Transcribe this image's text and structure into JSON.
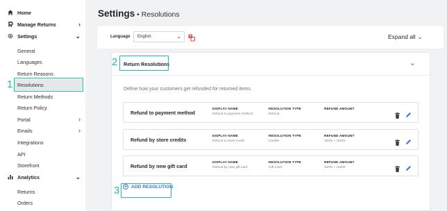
{
  "sidebar": {
    "items": [
      {
        "label": "Home",
        "icon": "home-icon",
        "section": true
      },
      {
        "label": "Manage Returns",
        "icon": "returns-icon",
        "section": true,
        "chevron": "›"
      },
      {
        "label": "Settings",
        "icon": "gear-icon",
        "section": true,
        "chevron": "⌄"
      },
      {
        "label": "General"
      },
      {
        "label": "Languages"
      },
      {
        "label": "Return Reasons"
      },
      {
        "label": "Resolutions",
        "active": true
      },
      {
        "label": "Return Methods"
      },
      {
        "label": "Return Policy"
      },
      {
        "label": "Portal",
        "chevron": "›"
      },
      {
        "label": "Emails",
        "chevron": "›"
      },
      {
        "label": "Integrations"
      },
      {
        "label": "API"
      },
      {
        "label": "Storefront"
      },
      {
        "label": "Analytics",
        "icon": "bar-chart-icon",
        "section": true,
        "chevron": "⌄"
      },
      {
        "label": "Returns"
      },
      {
        "label": "Orders"
      }
    ]
  },
  "annotations": {
    "one": "1",
    "two": "2",
    "three": "3",
    "color": "#1fbf9c"
  },
  "header": {
    "title": "Settings",
    "separator": " • ",
    "subtitle": "Resolutions"
  },
  "toolbar": {
    "language_label": "Language",
    "language_value": "English",
    "expand_all": "Expand all"
  },
  "panel": {
    "title": "Return Resolutions",
    "description": "Define how your customers get refunded for returned items.",
    "columns": {
      "display_name": "DISPLAY NAME",
      "resolution_type": "RESOLUTION TYPE",
      "refund_amount": "REFUND AMOUNT"
    },
    "resolutions": [
      {
        "name": "Refund to payment method",
        "display_name": "Refund to payment method",
        "type": "Refund",
        "amount": ""
      },
      {
        "name": "Refund by store credits",
        "display_name": "Refund to store credit",
        "type": "Credits",
        "amount": "100% + USD0"
      },
      {
        "name": "Refund by new gift card",
        "display_name": "Refund by new gift card",
        "type": "Gift Card",
        "amount": "100% + USD0"
      }
    ],
    "add_label": "ADD RESOLUTION"
  },
  "colors": {
    "accent": "#3f6fd8",
    "highlight": "#1fbf9c",
    "background": "#f1f2f4"
  }
}
